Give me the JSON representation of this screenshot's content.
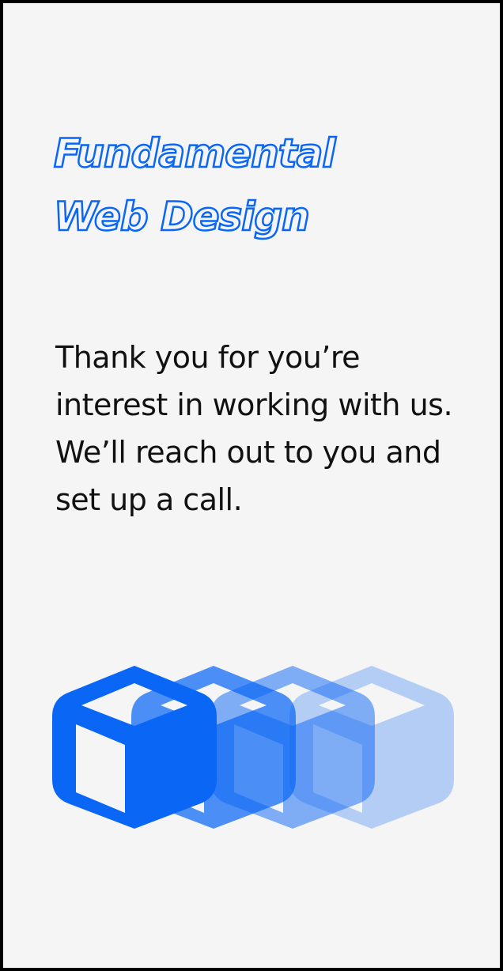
{
  "brand": {
    "title_line1": "Fundamental",
    "title_line2": "Web Design",
    "accent_color": "#0a66f5"
  },
  "message": {
    "text": "Thank you for you’re interest in working with us. We’ll reach out to you and set up a call."
  },
  "graphic": {
    "icon": "cube-icon",
    "copies": 4,
    "opacities": [
      1,
      0.72,
      0.5,
      0.28
    ]
  }
}
